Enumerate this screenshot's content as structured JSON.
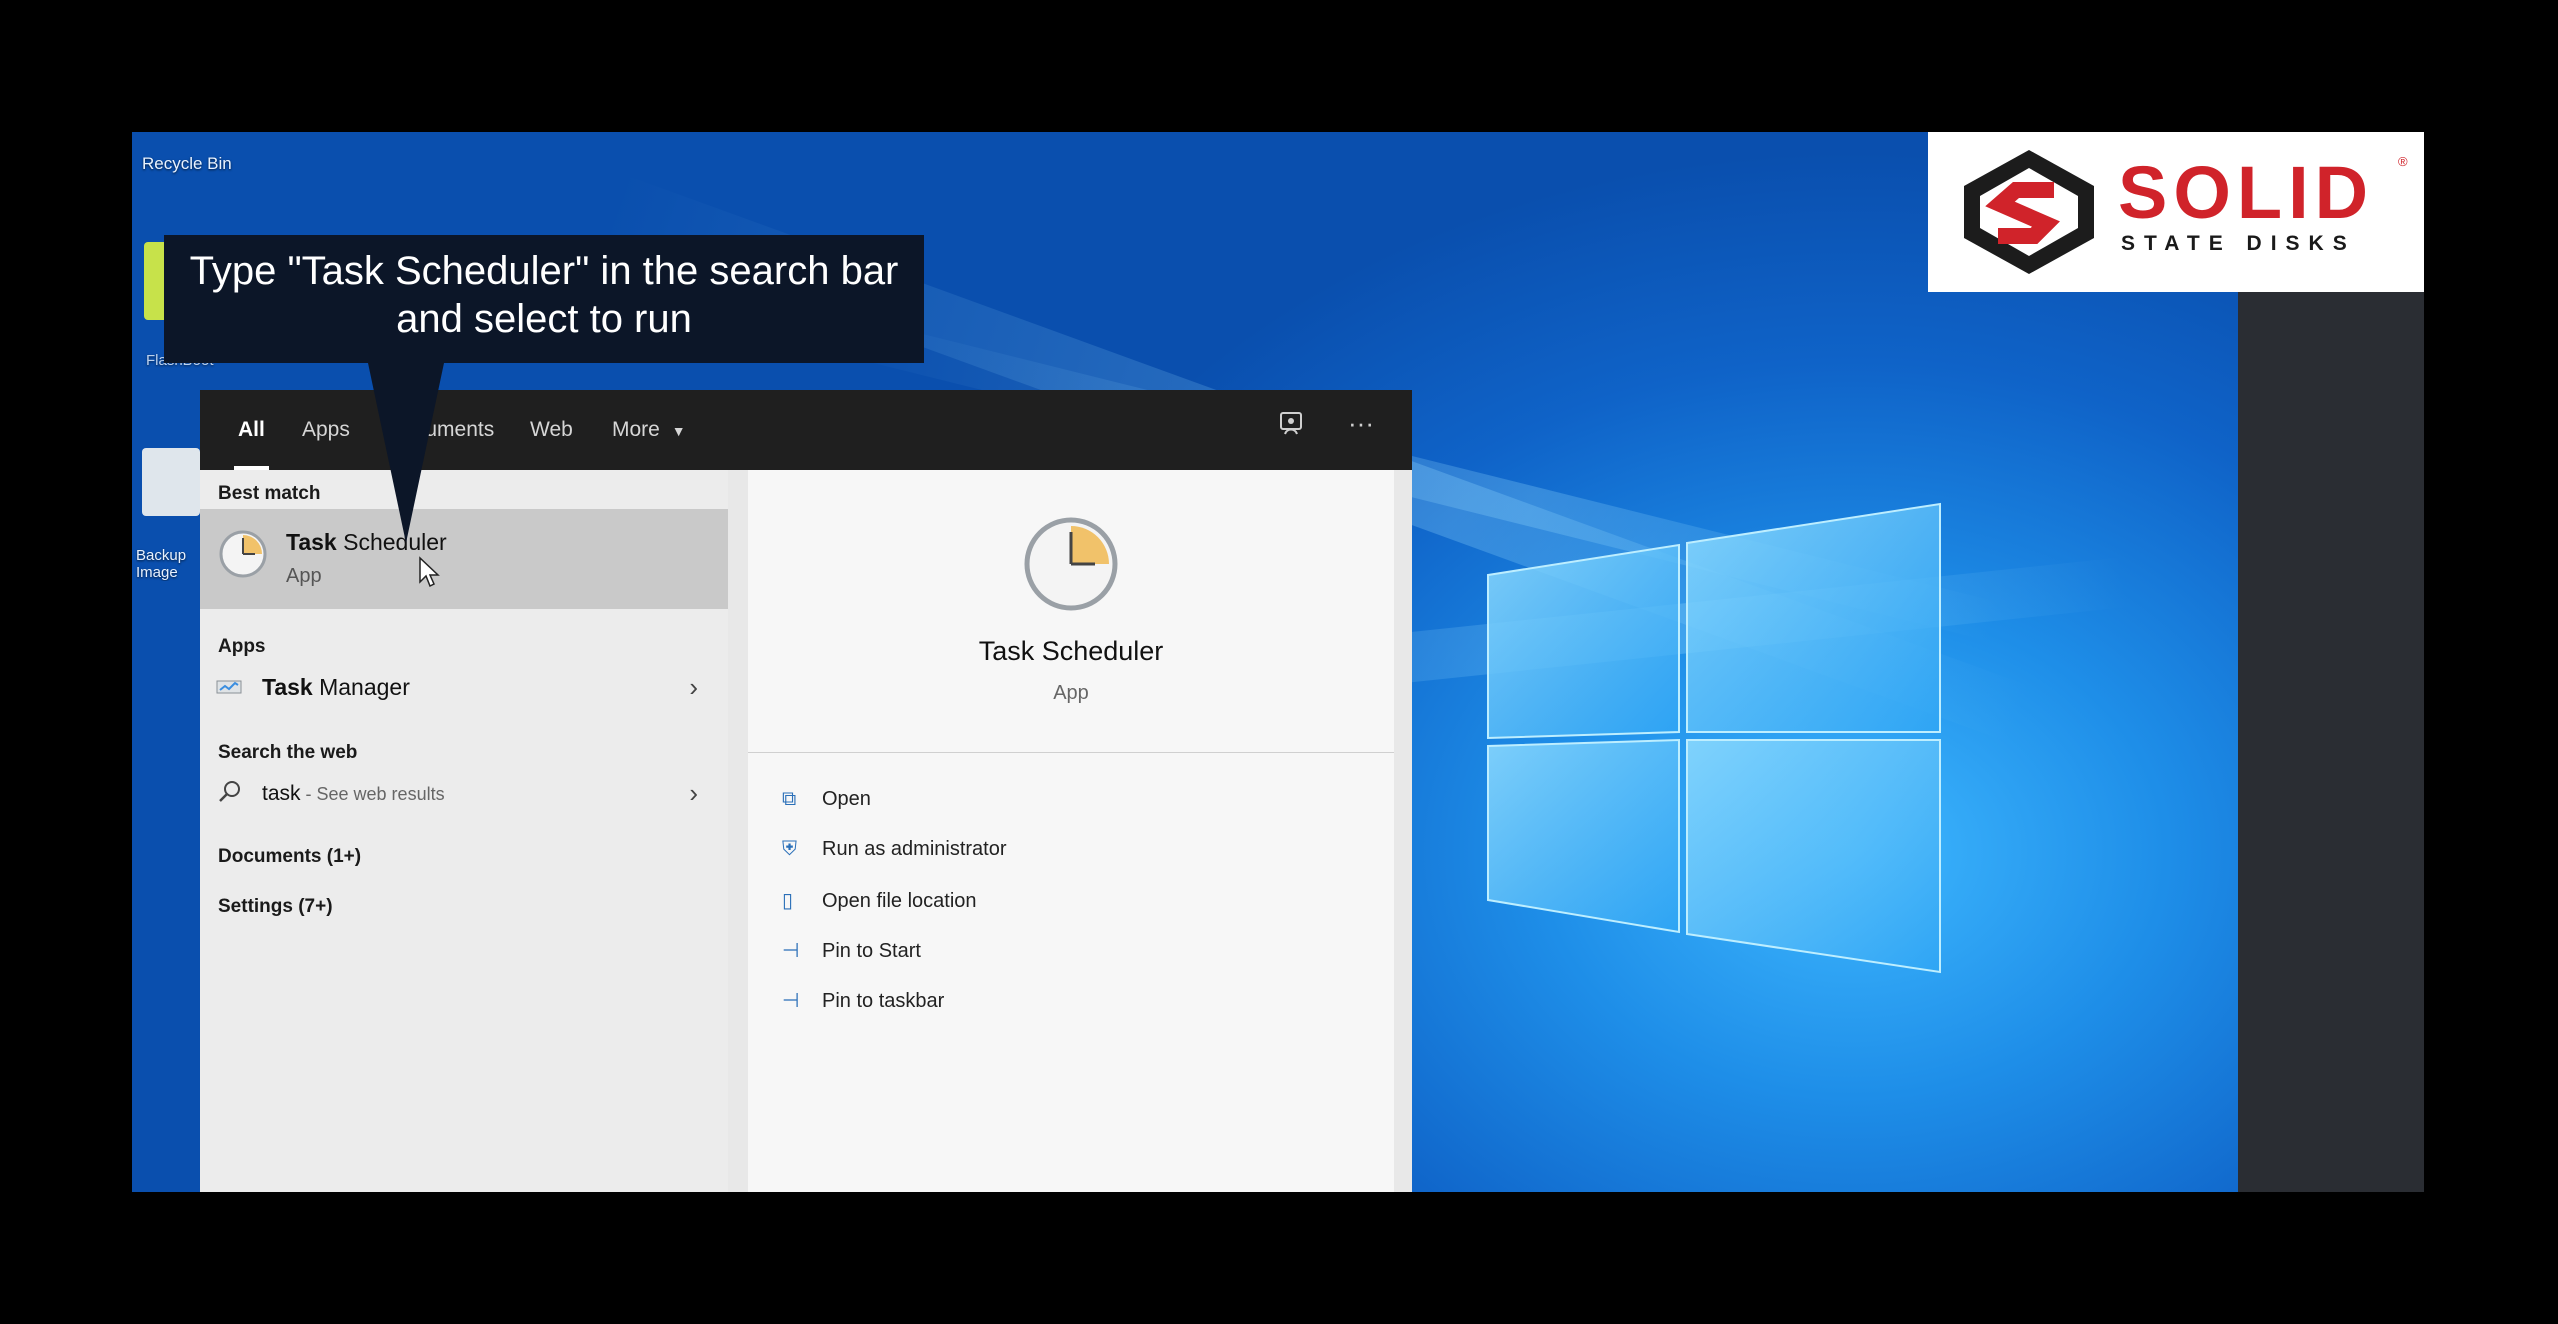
{
  "desktop": {
    "icons": [
      {
        "label": "Recycle Bin"
      },
      {
        "label": "FlashBoot"
      },
      {
        "label": "Backup Image"
      }
    ]
  },
  "logo": {
    "word": "SOLID",
    "registered": "®",
    "tagline": "STATE DISKS",
    "color": "#d0232a"
  },
  "caption": {
    "line1": "Type \"Task Scheduler\" in the search bar",
    "line2": "and select to run"
  },
  "search": {
    "tabs": [
      "All",
      "Apps",
      "Documents",
      "Web",
      "More"
    ],
    "active_tab": "All",
    "more_icon": "caret-down-icon",
    "feedback_icon": "feedback-icon",
    "ellipsis": "···",
    "best_match_header": "Best match",
    "best_match": {
      "bold": "Task",
      "rest": " Scheduler",
      "type": "App"
    },
    "apps_header": "Apps",
    "apps": [
      {
        "bold": "Task",
        "rest": " Manager"
      }
    ],
    "web_header": "Search the web",
    "web": {
      "query": "task",
      "hint": " - See web results"
    },
    "documents": "Documents (1+)",
    "settings": "Settings (7+)"
  },
  "detail": {
    "title": "Task Scheduler",
    "subtitle": "App",
    "actions": [
      {
        "label": "Open",
        "icon": "open-icon"
      },
      {
        "label": "Run as administrator",
        "icon": "admin-icon"
      },
      {
        "label": "Open file location",
        "icon": "folder-icon"
      },
      {
        "label": "Pin to Start",
        "icon": "pin-icon"
      },
      {
        "label": "Pin to taskbar",
        "icon": "pin-icon"
      }
    ]
  }
}
